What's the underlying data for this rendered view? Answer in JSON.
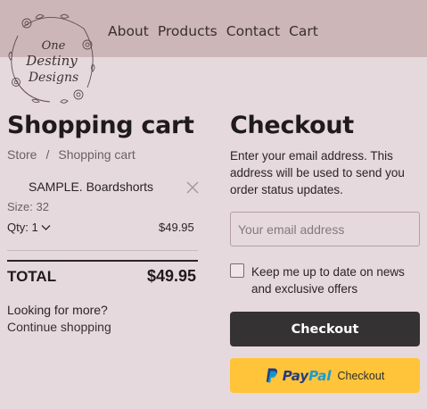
{
  "brand": {
    "logo_line1": "One",
    "logo_line2": "Destiny",
    "logo_line3": "Designs"
  },
  "nav": {
    "items": [
      "About",
      "Products",
      "Contact",
      "Cart"
    ]
  },
  "cart": {
    "title": "Shopping cart",
    "breadcrumb": [
      "Store",
      "Shopping cart"
    ],
    "breadcrumb_separator": "/",
    "item": {
      "name": "SAMPLE. Boardshorts",
      "size": "Size: 32",
      "qty": "Qty: 1",
      "price": "$49.95"
    },
    "total_label": "TOTAL",
    "total_value": "$49.95",
    "more_text": "Looking for more?",
    "continue_link": "Continue shopping"
  },
  "checkout": {
    "title": "Checkout",
    "instructions": "Enter your email address. This address will be used to send you order status updates.",
    "email_placeholder": "Your email address",
    "newsletter_label": "Keep me up to date on news and exclusive offers",
    "checkout_button": "Checkout",
    "paypal_pay": "Pay",
    "paypal_pal": "Pal",
    "paypal_checkout": "Checkout"
  },
  "colors": {
    "background": "#e6d9dd",
    "header": "#ccb6b8",
    "checkout_button": "#353233",
    "paypal_button": "#ffc439",
    "paypal_dark_blue": "#253b80",
    "paypal_light_blue": "#179bd7"
  },
  "icons": {
    "remove": "close-icon",
    "qty_dropdown": "chevron-down-icon",
    "paypal": "paypal-logo-icon"
  }
}
